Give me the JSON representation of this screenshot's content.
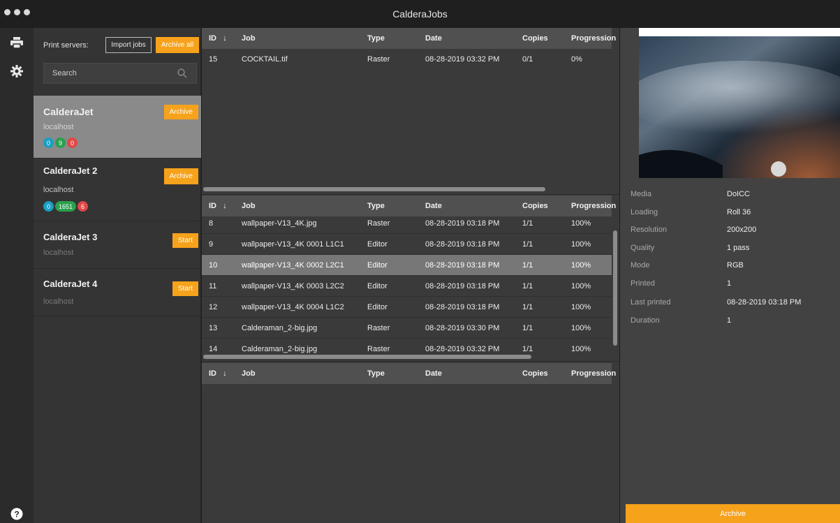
{
  "window": {
    "title": "CalderaJobs"
  },
  "servers_panel": {
    "label": "Print servers:",
    "import_label": "Import jobs",
    "archive_all_label": "Archive all",
    "search_placeholder": "Search",
    "servers": [
      {
        "name": "CalderaJet",
        "host": "localhost",
        "action": "Archive",
        "badges": [
          "0",
          "9",
          "0"
        ]
      },
      {
        "name": "CalderaJet 2",
        "host": "localhost",
        "action": "Archive",
        "badges": [
          "0",
          "1651",
          "6"
        ]
      },
      {
        "name": "CalderaJet 3",
        "host": "localhost",
        "action": "Start"
      },
      {
        "name": "CalderaJet 4",
        "host": "localhost",
        "action": "Start"
      }
    ]
  },
  "columns": {
    "id": "ID",
    "sort_icon": "↓",
    "job": "Job",
    "type": "Type",
    "date": "Date",
    "copies": "Copies",
    "progression": "Progression"
  },
  "active_jobs": [
    {
      "id": "15",
      "job": "COCKTAIL.tif",
      "type": "Raster",
      "date": "08-28-2019 03:32 PM",
      "copies": "0/1",
      "progression": "0%"
    }
  ],
  "printed_jobs": [
    {
      "id": "8",
      "job": "wallpaper-V13_4K.jpg",
      "type": "Raster",
      "date": "08-28-2019 03:18 PM",
      "copies": "1/1",
      "progression": "100%"
    },
    {
      "id": "9",
      "job": "wallpaper-V13_4K 0001 L1C1",
      "type": "Editor",
      "date": "08-28-2019 03:18 PM",
      "copies": "1/1",
      "progression": "100%"
    },
    {
      "id": "10",
      "job": "wallpaper-V13_4K 0002 L2C1",
      "type": "Editor",
      "date": "08-28-2019 03:18 PM",
      "copies": "1/1",
      "progression": "100%"
    },
    {
      "id": "11",
      "job": "wallpaper-V13_4K 0003 L2C2",
      "type": "Editor",
      "date": "08-28-2019 03:18 PM",
      "copies": "1/1",
      "progression": "100%"
    },
    {
      "id": "12",
      "job": "wallpaper-V13_4K 0004 L1C2",
      "type": "Editor",
      "date": "08-28-2019 03:18 PM",
      "copies": "1/1",
      "progression": "100%"
    },
    {
      "id": "13",
      "job": "Calderaman_2-big.jpg",
      "type": "Raster",
      "date": "08-28-2019 03:30 PM",
      "copies": "1/1",
      "progression": "100%"
    },
    {
      "id": "14",
      "job": "Calderaman_2-big.jpg",
      "type": "Raster",
      "date": "08-28-2019 03:32 PM",
      "copies": "1/1",
      "progression": "100%"
    }
  ],
  "detail": {
    "properties": [
      {
        "label": "Media",
        "value": "DoICC"
      },
      {
        "label": "Loading",
        "value": "Roll 36"
      },
      {
        "label": "Resolution",
        "value": "200x200"
      },
      {
        "label": "Quality",
        "value": "1 pass"
      },
      {
        "label": "Mode",
        "value": "RGB"
      },
      {
        "label": "Printed",
        "value": "1"
      },
      {
        "label": "Last printed",
        "value": "08-28-2019 03:18 PM"
      },
      {
        "label": "Duration",
        "value": "1"
      }
    ],
    "archive_label": "Archive"
  },
  "colors": {
    "accent": "#f7a21b",
    "selected_row": "#777777",
    "header": "#505050"
  },
  "icons": {
    "rail": [
      "printer-icon",
      "gear-icon",
      "help-icon"
    ],
    "search": "search-icon"
  }
}
